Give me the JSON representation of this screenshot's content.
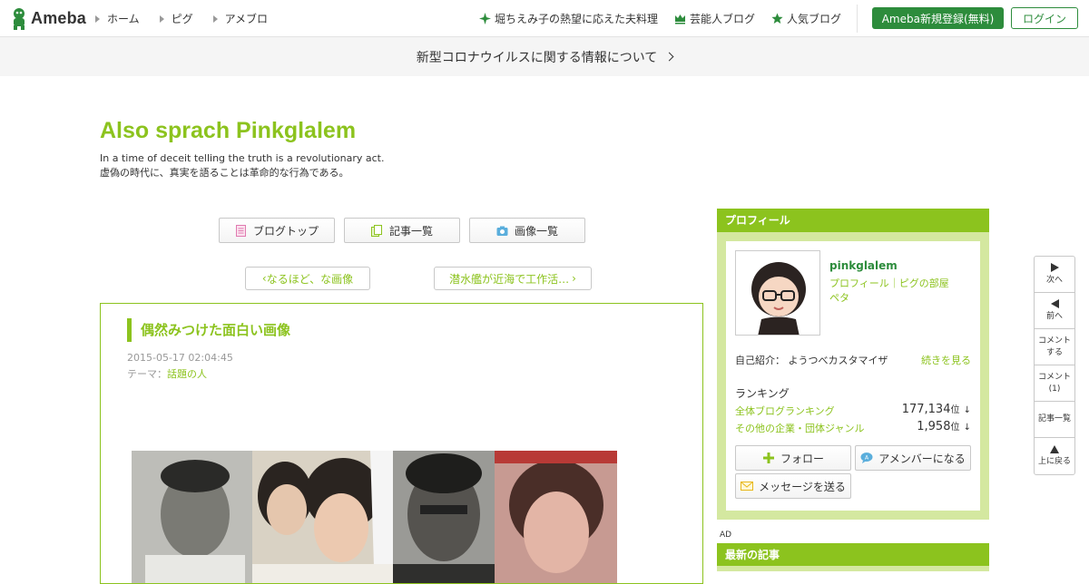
{
  "header": {
    "logo_text": "Ameba",
    "nav": [
      "ホーム",
      "ピグ",
      "アメブロ"
    ],
    "right_nav": [
      "堀ちえみ子の熱望に応えた夫料理",
      "芸能人ブログ",
      "人気ブログ"
    ],
    "register_label": "Ameba新規登録(無料)",
    "login_label": "ログイン"
  },
  "notice": {
    "text": "新型コロナウイルスに関する情報について"
  },
  "blog": {
    "title": "Also sprach Pinkglalem",
    "desc_en": "In a time of deceit telling the truth is a revolutionary act.",
    "desc_ja": "虚偽の時代に、真実を語ることは革命的な行為である。"
  },
  "blog_nav": {
    "top_label": "ブログトップ",
    "entries_label": "記事一覧",
    "images_label": "画像一覧",
    "prev_label": "なるほど、な画像",
    "next_label": "潜水艦が近海で工作活…"
  },
  "article": {
    "title": "偶然みつけた面白い画像",
    "date": "2015-05-17 02:04:45",
    "theme_prefix": "テーマ：",
    "theme": "話題の人"
  },
  "sidebar": {
    "profile_header": "プロフィール",
    "name": "pinkglalem",
    "links": [
      "プロフィール｜ピグの部屋",
      "ペタ"
    ],
    "intro_label": "自己紹介：",
    "intro_text": "ようつべカスタマイザ",
    "intro_more": "続きを見る",
    "ranking_title": "ランキング",
    "rankings": [
      {
        "label": "全体ブログランキング",
        "value": "177,134",
        "unit": "位",
        "arrow": "↓"
      },
      {
        "label": "その他の企業・団体ジャンル",
        "value": "1,958",
        "unit": "位",
        "arrow": "↓"
      }
    ],
    "follow_label": "フォロー",
    "amember_label": "アメンバーになる",
    "message_label": "メッセージを送る",
    "ad_label": "AD",
    "latest_header": "最新の記事"
  },
  "float_nav": {
    "next": "次へ",
    "prev": "前へ",
    "comment_do_1": "コメント",
    "comment_do_2": "する",
    "comment_count_1": "コメント",
    "comment_count_2": "(1)",
    "entries": "記事一覧",
    "top": "上に戻る"
  },
  "colors": {
    "accent": "#8cc31e",
    "brand": "#2d8c3c",
    "sidebar_bg": "#d4e8a0"
  }
}
